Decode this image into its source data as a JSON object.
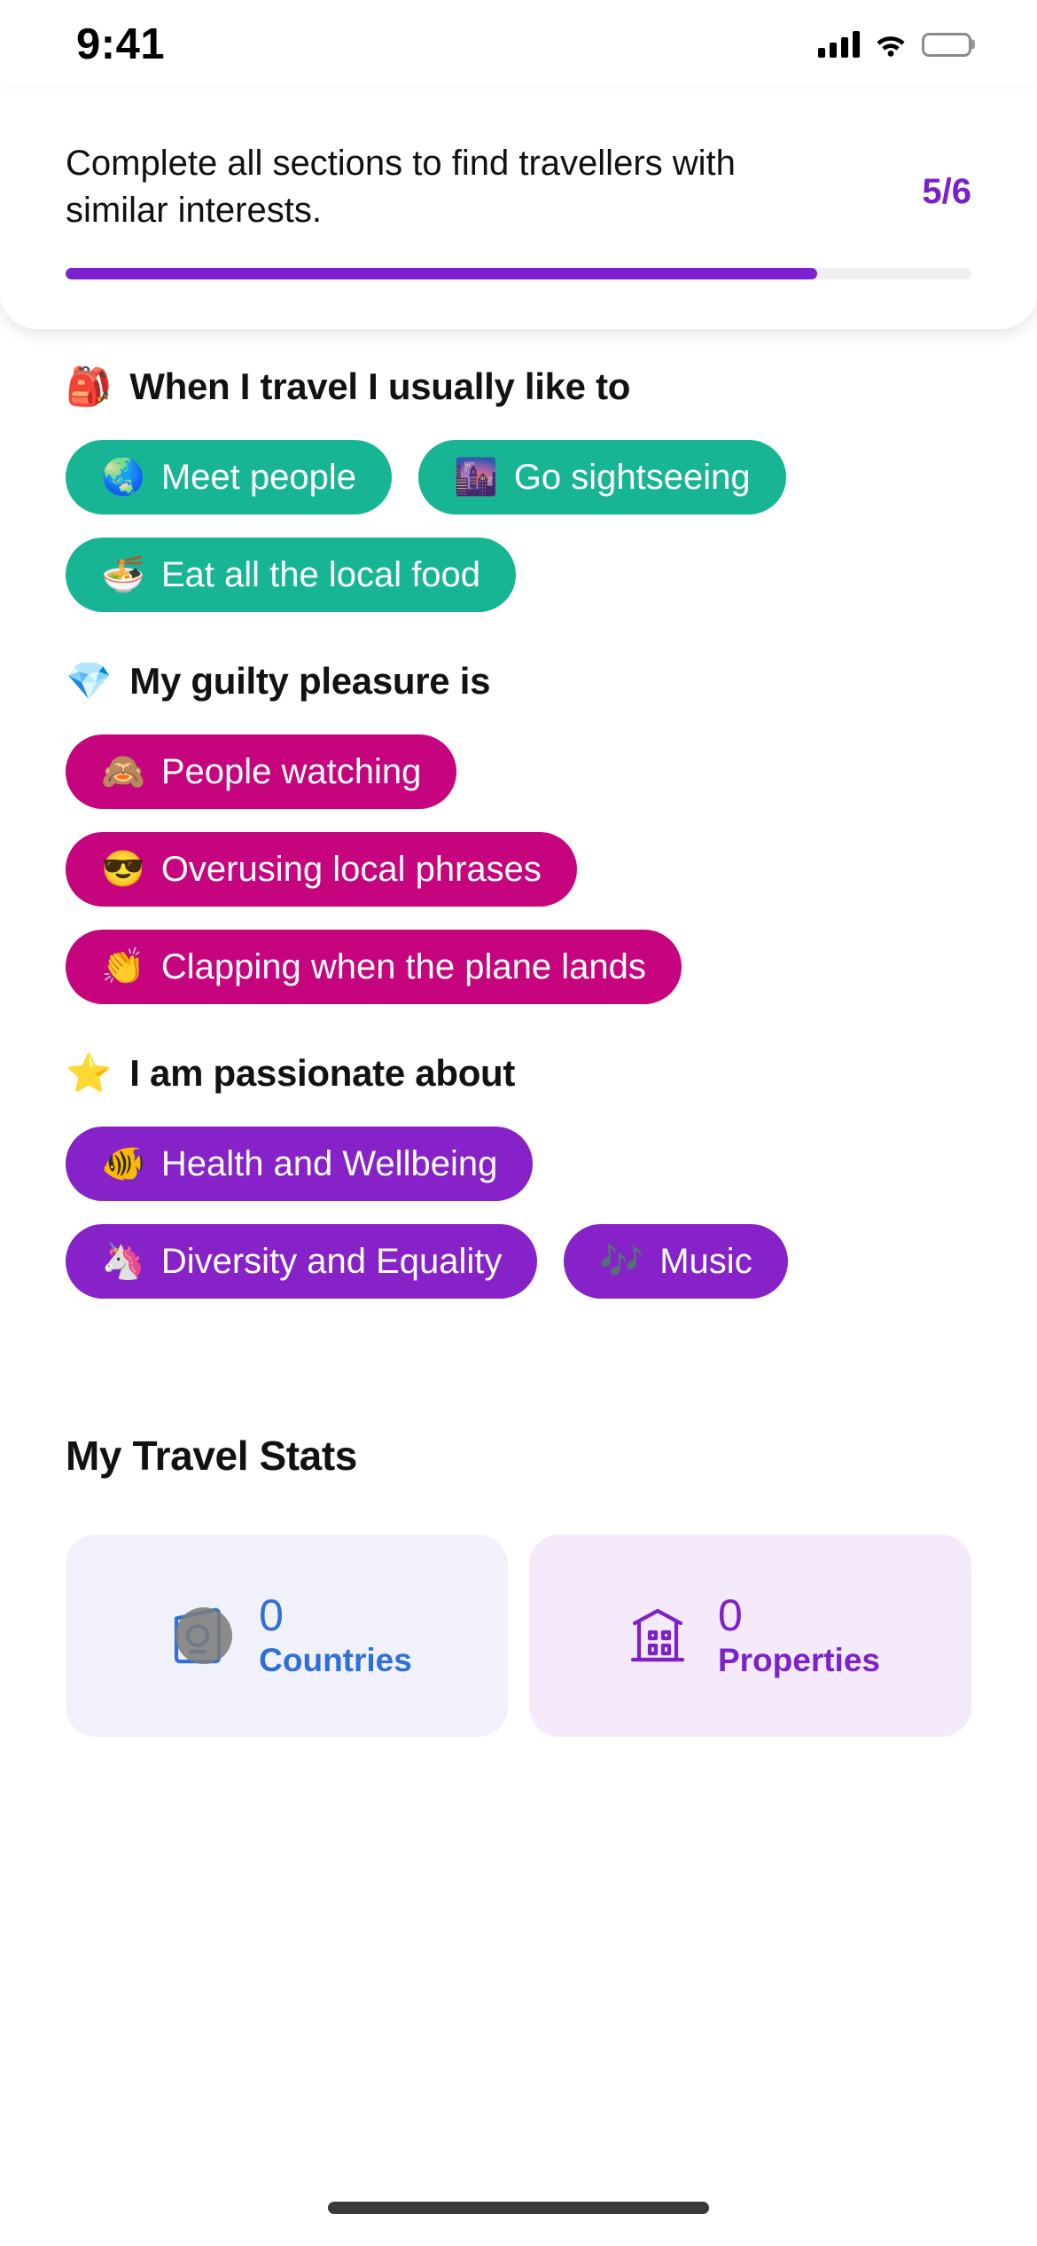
{
  "status_bar": {
    "time": "9:41",
    "cellular_icon": "cellular-bars-icon",
    "wifi_icon": "wifi-icon",
    "battery_icon": "battery-full-icon"
  },
  "progress": {
    "message": "Complete all sections to find travellers with similar interests.",
    "count_label": "5/6",
    "completed": 5,
    "total": 6,
    "percent": 83,
    "accent_color": "#7D21D0",
    "track_color": "#EFEFF2"
  },
  "sections": [
    {
      "emoji": "🎒",
      "emoji_name": "backpack-emoji",
      "title": "When I travel I usually like to",
      "chip_color": "#17B594",
      "chip_style": "teal",
      "chips": [
        {
          "emoji": "🌏",
          "emoji_name": "globe-asia-emoji",
          "label": "Meet people"
        },
        {
          "emoji": "🌆",
          "emoji_name": "cityscape-dusk-emoji",
          "label": "Go sightseeing"
        },
        {
          "emoji": "🍜",
          "emoji_name": "steaming-bowl-emoji",
          "label": "Eat all the local food"
        }
      ]
    },
    {
      "emoji": "💎",
      "emoji_name": "gem-stone-emoji",
      "title": "My guilty pleasure is",
      "chip_color": "#C5047E",
      "chip_style": "pink",
      "chips": [
        {
          "emoji": "🙈",
          "emoji_name": "see-no-evil-monkey-emoji",
          "label": "People watching"
        },
        {
          "emoji": "😎",
          "emoji_name": "smiling-face-sunglasses-emoji",
          "label": "Overusing local phrases"
        },
        {
          "emoji": "👏",
          "emoji_name": "clapping-hands-emoji",
          "label": "Clapping when the plane lands"
        }
      ]
    },
    {
      "emoji": "⭐",
      "emoji_name": "star-emoji",
      "title": "I am passionate about",
      "chip_color": "#8622C8",
      "chip_style": "purple",
      "chips": [
        {
          "emoji": "🐠",
          "emoji_name": "tropical-fish-emoji",
          "label": "Health and Wellbeing"
        },
        {
          "emoji": "🦄",
          "emoji_name": "unicorn-emoji",
          "label": "Diversity and Equality"
        },
        {
          "emoji": "🎶",
          "emoji_name": "musical-notes-emoji",
          "label": "Music"
        }
      ]
    }
  ],
  "travel_stats": {
    "title": "My Travel Stats",
    "cards": [
      {
        "icon_name": "passport-icon",
        "value": "0",
        "label": "Countries",
        "accent_color": "#2F6FD8",
        "background_color": "#F1F1FC"
      },
      {
        "icon_name": "property-house-icon",
        "value": "0",
        "label": "Properties",
        "accent_color": "#7D21C8",
        "background_color": "#F5E9FC"
      }
    ]
  },
  "home_indicator": "home-indicator"
}
